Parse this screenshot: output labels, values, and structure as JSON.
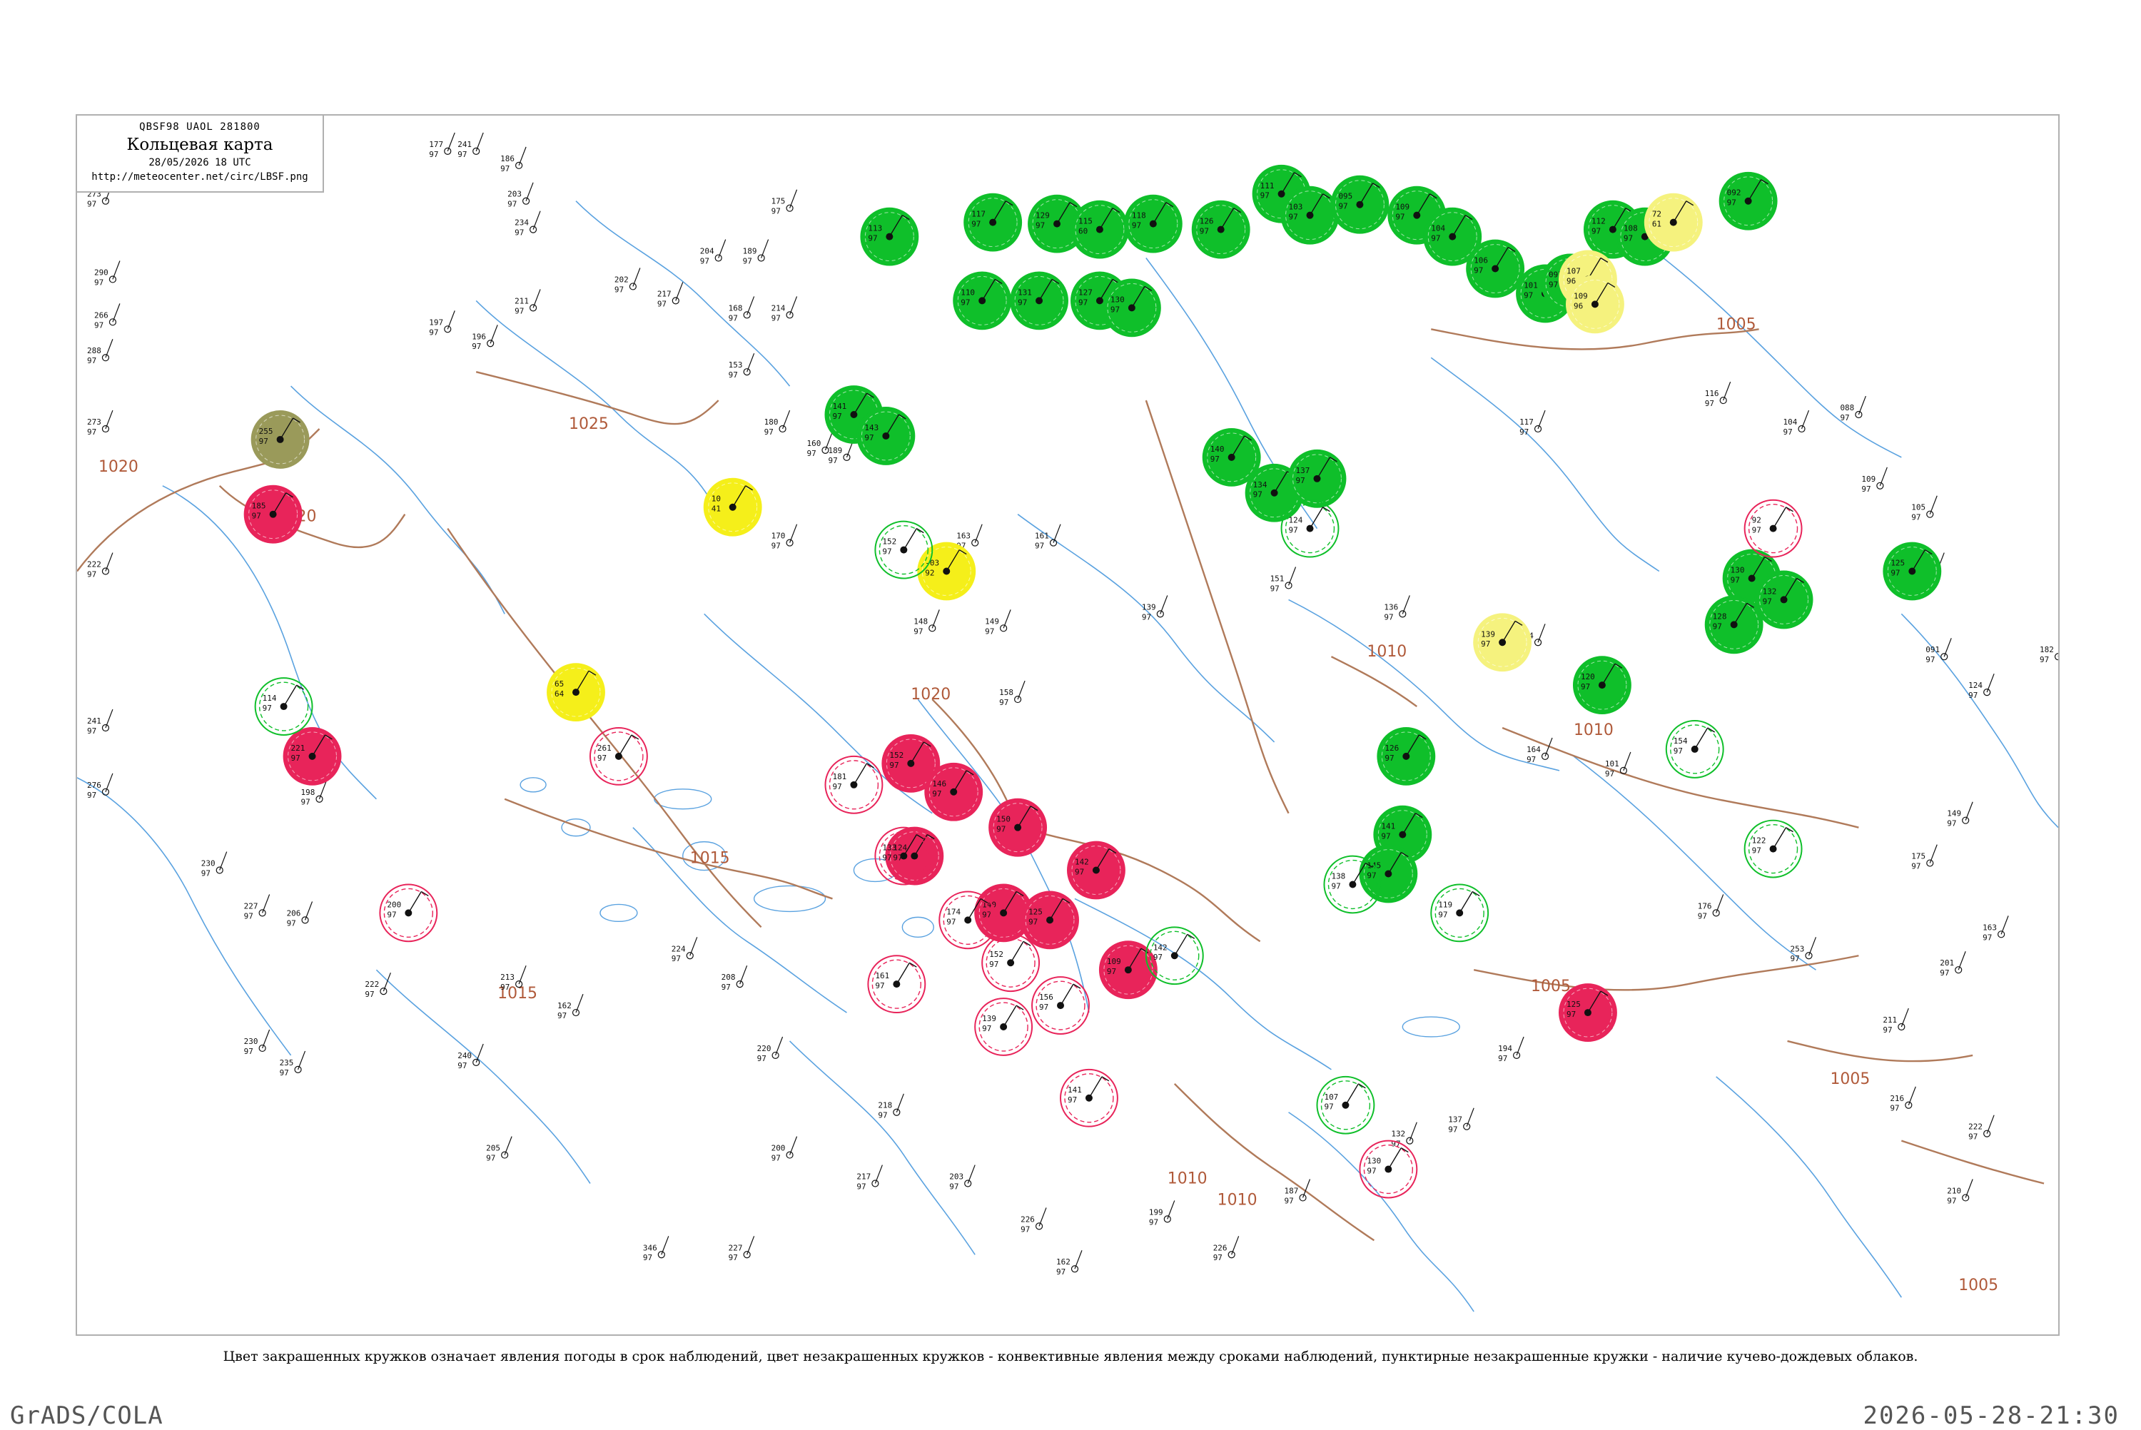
{
  "header": {
    "code": "QBSF98  UAOL  281800",
    "title": "Кольцевая карта",
    "date": "28/05/2026 18 UTC",
    "url": "http://meteocenter.net/circ/LBSF.png"
  },
  "caption": "Цвет закрашенных кружков означает явления погоды в срок наблюдений, цвет незакрашенных кружков - конвективные явления между сроками наблюдений, пунктирные незакрашенные кружки - наличие кучево-дождевых облаков.",
  "footer": {
    "left": "GrADS/COLA",
    "right": "2026-05-28-21:30"
  },
  "colors": {
    "green": "#0fbf2a",
    "red": "#e8245a",
    "yellow": "#f5ef1a",
    "light_yellow": "#f5f27e",
    "olive": "#9a9a5a",
    "isobar": "#b07a5a",
    "water": "#5aa2e0",
    "border": "#b0b0b0"
  },
  "isobars": [
    {
      "label": "1020"
    },
    {
      "label": "1020"
    },
    {
      "label": "1025"
    },
    {
      "label": "1015"
    },
    {
      "label": "1015"
    },
    {
      "label": "1020"
    },
    {
      "label": "1015"
    },
    {
      "label": "1010"
    },
    {
      "label": "1010"
    },
    {
      "label": "1010"
    },
    {
      "label": "1005"
    },
    {
      "label": "1005"
    },
    {
      "label": "1005"
    },
    {
      "label": "1005"
    },
    {
      "label": "1010"
    }
  ],
  "stations": [
    {
      "type": "filled",
      "color": "green",
      "t": "117",
      "v": "97"
    },
    {
      "type": "filled",
      "color": "green",
      "t": "129",
      "v": "97"
    },
    {
      "type": "filled",
      "color": "green",
      "t": "115",
      "v": "60"
    },
    {
      "type": "filled",
      "color": "green",
      "t": "118",
      "v": "97"
    },
    {
      "type": "filled",
      "color": "green",
      "t": "126",
      "v": "97"
    },
    {
      "type": "filled",
      "color": "green",
      "t": "111",
      "v": "97"
    },
    {
      "type": "filled",
      "color": "green",
      "t": "103",
      "v": "97"
    },
    {
      "type": "filled",
      "color": "green",
      "t": "095",
      "v": "97"
    },
    {
      "type": "filled",
      "color": "green",
      "t": "109",
      "v": "97"
    },
    {
      "type": "filled",
      "color": "green",
      "t": "104",
      "v": "97"
    },
    {
      "type": "filled",
      "color": "green",
      "t": "106",
      "v": "97"
    },
    {
      "type": "filled",
      "color": "green",
      "t": "101",
      "v": "97"
    },
    {
      "type": "filled",
      "color": "green",
      "t": "097",
      "v": "97"
    },
    {
      "type": "filled",
      "color": "green",
      "t": "112",
      "v": "97"
    },
    {
      "type": "filled",
      "color": "green",
      "t": "108",
      "v": "97"
    },
    {
      "type": "filled",
      "color": "green",
      "t": "092",
      "v": "97"
    },
    {
      "type": "filled",
      "color": "green",
      "t": "113",
      "v": "97"
    },
    {
      "type": "filled",
      "color": "green",
      "t": "110",
      "v": "97"
    },
    {
      "type": "filled",
      "color": "green",
      "t": "131",
      "v": "97"
    },
    {
      "type": "filled",
      "color": "green",
      "t": "127",
      "v": "97"
    },
    {
      "type": "filled",
      "color": "green",
      "t": "130",
      "v": "97"
    },
    {
      "type": "filled",
      "color": "green",
      "t": "140",
      "v": "97"
    },
    {
      "type": "filled",
      "color": "green",
      "t": "134",
      "v": "97"
    },
    {
      "type": "filled",
      "color": "green",
      "t": "137",
      "v": "97"
    },
    {
      "type": "filled",
      "color": "green",
      "t": "141",
      "v": "97"
    },
    {
      "type": "filled",
      "color": "green",
      "t": "143",
      "v": "97"
    },
    {
      "type": "filled",
      "color": "green",
      "t": "126",
      "v": "97"
    },
    {
      "type": "filled",
      "color": "green",
      "t": "141",
      "v": "97"
    },
    {
      "type": "filled",
      "color": "green",
      "t": "145",
      "v": "97"
    },
    {
      "type": "filled",
      "color": "green",
      "t": "130",
      "v": "97"
    },
    {
      "type": "filled",
      "color": "green",
      "t": "132",
      "v": "97"
    },
    {
      "type": "filled",
      "color": "green",
      "t": "128",
      "v": "97"
    },
    {
      "type": "filled",
      "color": "green",
      "t": "120",
      "v": "97"
    },
    {
      "type": "filled",
      "color": "green",
      "t": "125",
      "v": "97"
    },
    {
      "type": "filled",
      "color": "red",
      "t": "185",
      "v": "97"
    },
    {
      "type": "filled",
      "color": "red",
      "t": "221",
      "v": "97"
    },
    {
      "type": "filled",
      "color": "red",
      "t": "152",
      "v": "97"
    },
    {
      "type": "filled",
      "color": "red",
      "t": "146",
      "v": "97"
    },
    {
      "type": "filled",
      "color": "red",
      "t": "150",
      "v": "97"
    },
    {
      "type": "filled",
      "color": "red",
      "t": "142",
      "v": "97"
    },
    {
      "type": "filled",
      "color": "red",
      "t": "140",
      "v": "97"
    },
    {
      "type": "filled",
      "color": "red",
      "t": "125",
      "v": "97"
    },
    {
      "type": "filled",
      "color": "red",
      "t": "124",
      "v": "97"
    },
    {
      "type": "filled",
      "color": "red",
      "t": "109",
      "v": "97"
    },
    {
      "type": "filled",
      "color": "red",
      "t": "125",
      "v": "97"
    },
    {
      "type": "filled",
      "color": "yellow",
      "t": "10",
      "v": "41"
    },
    {
      "type": "filled",
      "color": "yellow",
      "t": "-03",
      "v": "92"
    },
    {
      "type": "filled",
      "color": "yellow",
      "t": "65",
      "v": "64"
    },
    {
      "type": "filled",
      "color": "light_yellow",
      "t": "72",
      "v": "61"
    },
    {
      "type": "filled",
      "color": "light_yellow",
      "t": "107",
      "v": "96"
    },
    {
      "type": "filled",
      "color": "light_yellow",
      "t": "109",
      "v": "96"
    },
    {
      "type": "filled",
      "color": "light_yellow",
      "t": "139",
      "v": "97"
    },
    {
      "type": "filled",
      "color": "olive",
      "t": "255",
      "v": "97"
    },
    {
      "type": "ring",
      "color": "green",
      "t": "114",
      "v": "97"
    },
    {
      "type": "ring",
      "color": "green",
      "t": "152",
      "v": "97"
    },
    {
      "type": "ring",
      "color": "green",
      "t": "124",
      "v": "97"
    },
    {
      "type": "ring",
      "color": "green",
      "t": "142",
      "v": "97"
    },
    {
      "type": "ring",
      "color": "green",
      "t": "138",
      "v": "97"
    },
    {
      "type": "ring",
      "color": "green",
      "t": "119",
      "v": "97"
    },
    {
      "type": "ring",
      "color": "green",
      "t": "154",
      "v": "97"
    },
    {
      "type": "ring",
      "color": "green",
      "t": "122",
      "v": "97"
    },
    {
      "type": "ring",
      "color": "green",
      "t": "107",
      "v": "97"
    },
    {
      "type": "ring",
      "color": "red",
      "t": "181",
      "v": "97"
    },
    {
      "type": "ring",
      "color": "red",
      "t": "261",
      "v": "97"
    },
    {
      "type": "ring",
      "color": "red",
      "t": "133",
      "v": "97"
    },
    {
      "type": "ring",
      "color": "red",
      "t": "161",
      "v": "97"
    },
    {
      "type": "ring",
      "color": "red",
      "t": "174",
      "v": "97"
    },
    {
      "type": "ring",
      "color": "red",
      "t": "152",
      "v": "97"
    },
    {
      "type": "ring",
      "color": "red",
      "t": "156",
      "v": "97"
    },
    {
      "type": "ring",
      "color": "red",
      "t": "139",
      "v": "97"
    },
    {
      "type": "ring",
      "color": "red",
      "t": "141",
      "v": "97"
    },
    {
      "type": "ring",
      "color": "red",
      "t": "200",
      "v": "97"
    },
    {
      "type": "ring",
      "color": "red",
      "t": "92",
      "v": "97"
    },
    {
      "type": "ring",
      "color": "red",
      "t": "130",
      "v": "97"
    },
    {
      "type": "plain",
      "t": "273",
      "v": "97"
    },
    {
      "type": "plain",
      "t": "290",
      "v": "97"
    },
    {
      "type": "plain",
      "t": "266",
      "v": "97"
    },
    {
      "type": "plain",
      "t": "288",
      "v": "97"
    },
    {
      "type": "plain",
      "t": "273",
      "v": "97"
    },
    {
      "type": "plain",
      "t": "222",
      "v": "97"
    },
    {
      "type": "plain",
      "t": "241",
      "v": "97"
    },
    {
      "type": "plain",
      "t": "276",
      "v": "97"
    },
    {
      "type": "plain",
      "t": "230",
      "v": "97"
    },
    {
      "type": "plain",
      "t": "227",
      "v": "97"
    },
    {
      "type": "plain",
      "t": "206",
      "v": "97"
    },
    {
      "type": "plain",
      "t": "198",
      "v": "97"
    },
    {
      "type": "plain",
      "t": "177",
      "v": "97"
    },
    {
      "type": "plain",
      "t": "241",
      "v": "97"
    },
    {
      "type": "plain",
      "t": "186",
      "v": "97"
    },
    {
      "type": "plain",
      "t": "203",
      "v": "97"
    },
    {
      "type": "plain",
      "t": "234",
      "v": "97"
    },
    {
      "type": "plain",
      "t": "211",
      "v": "97"
    },
    {
      "type": "plain",
      "t": "197",
      "v": "97"
    },
    {
      "type": "plain",
      "t": "196",
      "v": "97"
    },
    {
      "type": "plain",
      "t": "202",
      "v": "97"
    },
    {
      "type": "plain",
      "t": "217",
      "v": "97"
    },
    {
      "type": "plain",
      "t": "168",
      "v": "97"
    },
    {
      "type": "plain",
      "t": "214",
      "v": "97"
    },
    {
      "type": "plain",
      "t": "204",
      "v": "97"
    },
    {
      "type": "plain",
      "t": "189",
      "v": "97"
    },
    {
      "type": "plain",
      "t": "175",
      "v": "97"
    },
    {
      "type": "plain",
      "t": "153",
      "v": "97"
    },
    {
      "type": "plain",
      "t": "180",
      "v": "97"
    },
    {
      "type": "plain",
      "t": "160",
      "v": "97"
    },
    {
      "type": "plain",
      "t": "170",
      "v": "97"
    },
    {
      "type": "plain",
      "t": "189",
      "v": "97"
    },
    {
      "type": "plain",
      "t": "163",
      "v": "97"
    },
    {
      "type": "plain",
      "t": "148",
      "v": "97"
    },
    {
      "type": "plain",
      "t": "149",
      "v": "97"
    },
    {
      "type": "plain",
      "t": "158",
      "v": "97"
    },
    {
      "type": "plain",
      "t": "161",
      "v": "97"
    },
    {
      "type": "plain",
      "t": "139",
      "v": "97"
    },
    {
      "type": "plain",
      "t": "151",
      "v": "97"
    },
    {
      "type": "plain",
      "t": "136",
      "v": "97"
    },
    {
      "type": "plain",
      "t": "184",
      "v": "97"
    },
    {
      "type": "plain",
      "t": "164",
      "v": "97"
    },
    {
      "type": "plain",
      "t": "101",
      "v": "97"
    },
    {
      "type": "plain",
      "t": "117",
      "v": "97"
    },
    {
      "type": "plain",
      "t": "116",
      "v": "97"
    },
    {
      "type": "plain",
      "t": "104",
      "v": "97"
    },
    {
      "type": "plain",
      "t": "088",
      "v": "97"
    },
    {
      "type": "plain",
      "t": "109",
      "v": "97"
    },
    {
      "type": "plain",
      "t": "105",
      "v": "97"
    },
    {
      "type": "plain",
      "t": "087",
      "v": "97"
    },
    {
      "type": "plain",
      "t": "091",
      "v": "97"
    },
    {
      "type": "plain",
      "t": "124",
      "v": "97"
    },
    {
      "type": "plain",
      "t": "182",
      "v": "97"
    },
    {
      "type": "plain",
      "t": "149",
      "v": "97"
    },
    {
      "type": "plain",
      "t": "175",
      "v": "97"
    },
    {
      "type": "plain",
      "t": "163",
      "v": "97"
    },
    {
      "type": "plain",
      "t": "201",
      "v": "97"
    },
    {
      "type": "plain",
      "t": "222",
      "v": "97"
    },
    {
      "type": "plain",
      "t": "210",
      "v": "97"
    },
    {
      "type": "plain",
      "t": "216",
      "v": "97"
    },
    {
      "type": "plain",
      "t": "211",
      "v": "97"
    },
    {
      "type": "plain",
      "t": "253",
      "v": "97"
    },
    {
      "type": "plain",
      "t": "176",
      "v": "97"
    },
    {
      "type": "plain",
      "t": "188",
      "v": "97"
    },
    {
      "type": "plain",
      "t": "194",
      "v": "97"
    },
    {
      "type": "plain",
      "t": "137",
      "v": "97"
    },
    {
      "type": "plain",
      "t": "132",
      "v": "97"
    },
    {
      "type": "plain",
      "t": "187",
      "v": "97"
    },
    {
      "type": "plain",
      "t": "226",
      "v": "97"
    },
    {
      "type": "plain",
      "t": "199",
      "v": "97"
    },
    {
      "type": "plain",
      "t": "162",
      "v": "97"
    },
    {
      "type": "plain",
      "t": "226",
      "v": "97"
    },
    {
      "type": "plain",
      "t": "203",
      "v": "97"
    },
    {
      "type": "plain",
      "t": "217",
      "v": "97"
    },
    {
      "type": "plain",
      "t": "200",
      "v": "97"
    },
    {
      "type": "plain",
      "t": "220",
      "v": "97"
    },
    {
      "type": "plain",
      "t": "208",
      "v": "97"
    },
    {
      "type": "plain",
      "t": "224",
      "v": "97"
    },
    {
      "type": "plain",
      "t": "162",
      "v": "97"
    },
    {
      "type": "plain",
      "t": "213",
      "v": "97"
    },
    {
      "type": "plain",
      "t": "240",
      "v": "97"
    },
    {
      "type": "plain",
      "t": "222",
      "v": "97"
    },
    {
      "type": "plain",
      "t": "235",
      "v": "97"
    },
    {
      "type": "plain",
      "t": "230",
      "v": "97"
    },
    {
      "type": "plain",
      "t": "205",
      "v": "97"
    },
    {
      "type": "plain",
      "t": "218",
      "v": "97"
    },
    {
      "type": "plain",
      "t": "346",
      "v": "97"
    },
    {
      "type": "plain",
      "t": "227",
      "v": "97"
    }
  ]
}
